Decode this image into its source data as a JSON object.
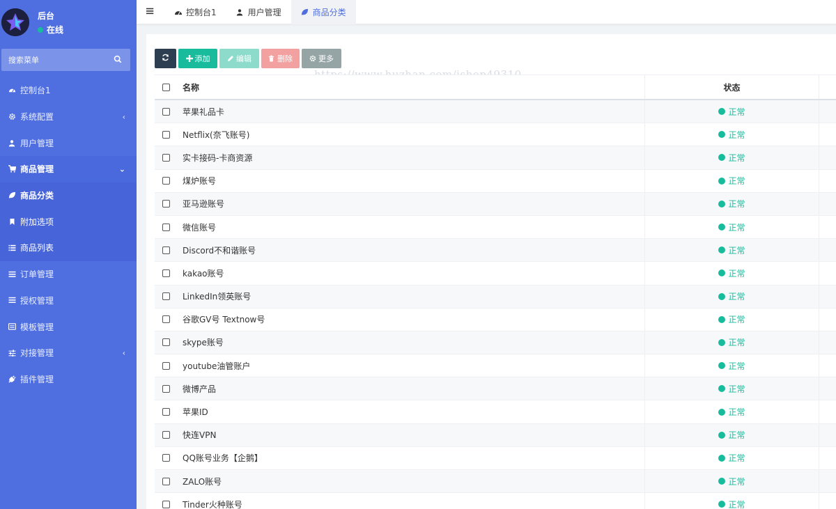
{
  "sidebar": {
    "user": {
      "name": "后台",
      "status": "在线"
    },
    "search": {
      "placeholder": "搜索菜单"
    },
    "items": [
      {
        "label": "控制台1",
        "icon": "dashboard-icon"
      },
      {
        "label": "系统配置",
        "icon": "gear-icon",
        "arrow": "‹"
      },
      {
        "label": "用户管理",
        "icon": "user-icon"
      },
      {
        "label": "商品管理",
        "icon": "cart-icon",
        "arrow": "⌄"
      },
      {
        "label": "商品分类",
        "icon": "leaf-icon"
      },
      {
        "label": "附加选项",
        "icon": "bookmark-icon"
      },
      {
        "label": "商品列表",
        "icon": "list-icon"
      },
      {
        "label": "订单管理",
        "icon": "bars-icon"
      },
      {
        "label": "授权管理",
        "icon": "bars-icon"
      },
      {
        "label": "模板管理",
        "icon": "template-icon"
      },
      {
        "label": "对接管理",
        "icon": "sliders-icon",
        "arrow": "‹"
      },
      {
        "label": "插件管理",
        "icon": "plug-icon"
      }
    ]
  },
  "header": {
    "tabs": [
      {
        "label": "控制台1",
        "icon": "dashboard-icon"
      },
      {
        "label": "用户管理",
        "icon": "user-icon"
      },
      {
        "label": "商品分类",
        "icon": "leaf-icon"
      }
    ]
  },
  "toolbar": {
    "add": "添加",
    "edit": "编辑",
    "delete": "删除",
    "more": "更多"
  },
  "watermark": "https://www.huzhan.com/ishop49310",
  "table": {
    "headers": {
      "name": "名称",
      "status": "状态"
    },
    "rows": [
      {
        "name": "苹果礼品卡",
        "status": "正常"
      },
      {
        "name": "Netflix(奈飞账号)",
        "status": "正常"
      },
      {
        "name": "实卡接码-卡商资源",
        "status": "正常"
      },
      {
        "name": "煤炉账号",
        "status": "正常"
      },
      {
        "name": "亚马逊账号",
        "status": "正常"
      },
      {
        "name": "微信账号",
        "status": "正常"
      },
      {
        "name": "Discord不和谐账号",
        "status": "正常"
      },
      {
        "name": "kakao账号",
        "status": "正常"
      },
      {
        "name": "LinkedIn领英账号",
        "status": "正常"
      },
      {
        "name": "谷歌GV号 Textnow号",
        "status": "正常"
      },
      {
        "name": "skype账号",
        "status": "正常"
      },
      {
        "name": "youtube油管账户",
        "status": "正常"
      },
      {
        "name": "微博产品",
        "status": "正常"
      },
      {
        "name": "苹果ID",
        "status": "正常"
      },
      {
        "name": "快连VPN",
        "status": "正常"
      },
      {
        "name": "QQ账号业务【企鹅】",
        "status": "正常"
      },
      {
        "name": "ZALO账号",
        "status": "正常"
      },
      {
        "name": "Tinder火种账号",
        "status": "正常"
      }
    ]
  }
}
